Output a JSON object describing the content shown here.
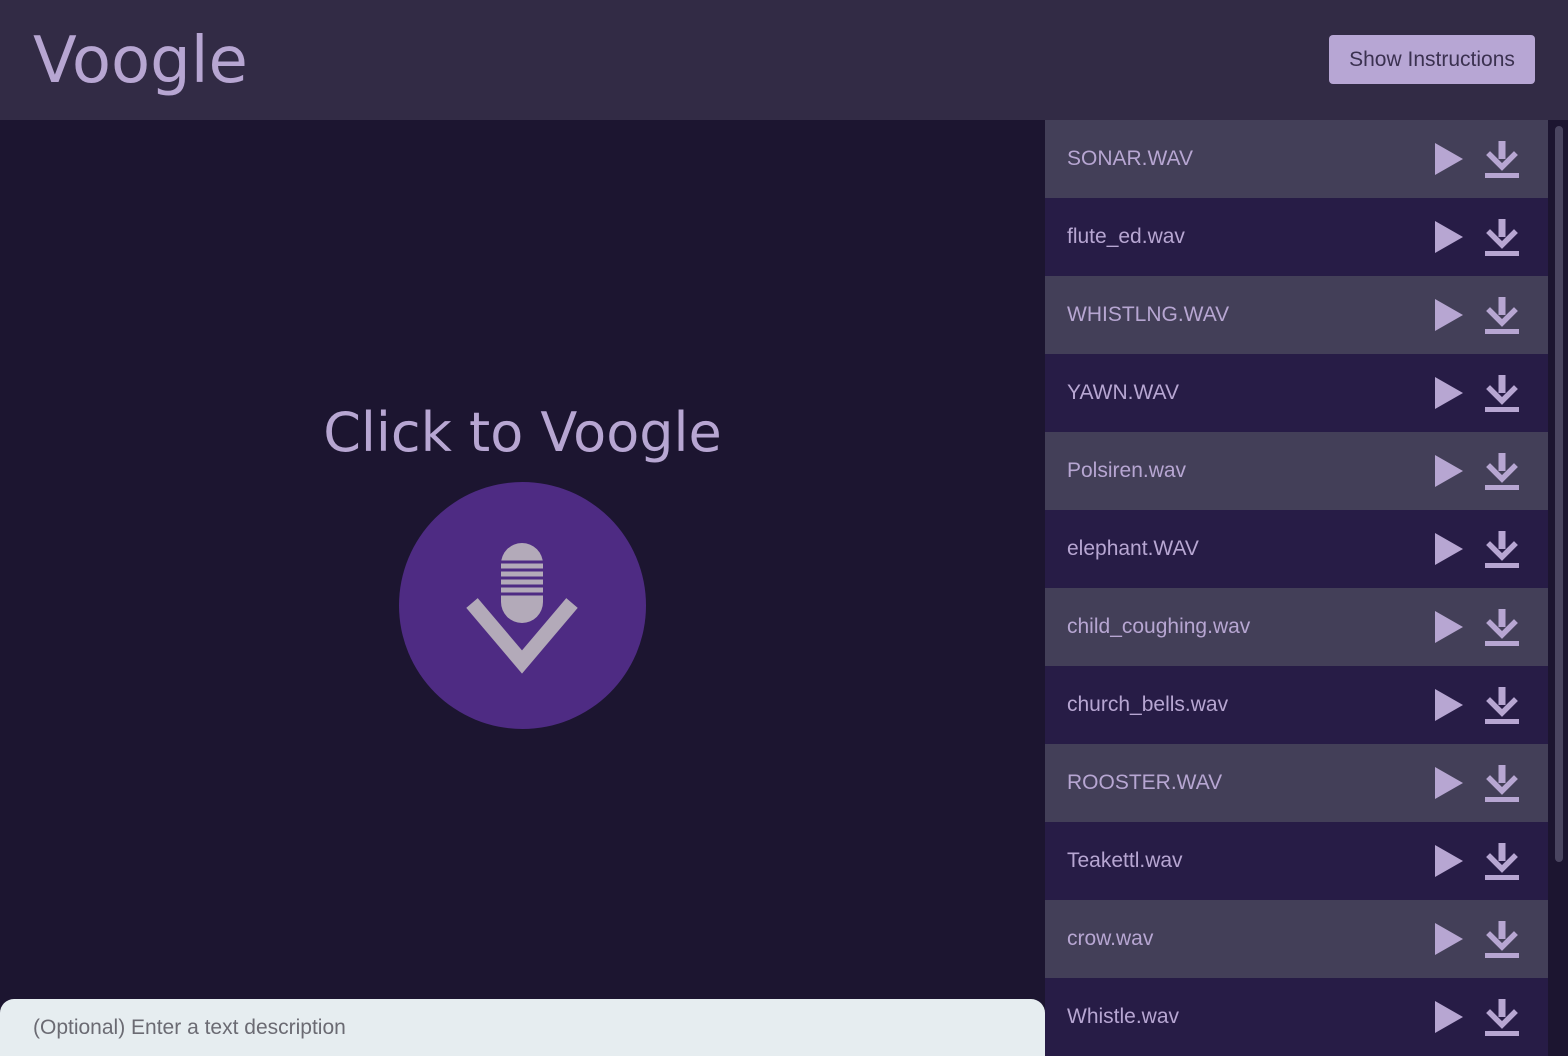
{
  "header": {
    "title": "Voogle",
    "instructions_button": "Show Instructions"
  },
  "main": {
    "cta": "Click to Voogle",
    "mic_icon": "microphone-voogle-icon",
    "search_placeholder": "(Optional) Enter a text description"
  },
  "sounds": [
    "SONAR.WAV",
    "flute_ed.wav",
    "WHISTLNG.WAV",
    "YAWN.WAV",
    "Polsiren.wav",
    "elephant.WAV",
    "child_coughing.wav",
    "church_bells.wav",
    "ROOSTER.WAV",
    "Teakettl.wav",
    "crow.wav",
    "Whistle.wav"
  ],
  "icons": {
    "play": "play-icon",
    "download": "download-icon"
  },
  "colors": {
    "header_bg": "#322b45",
    "main_bg": "#1c1530",
    "accent_text": "#b7a6d2",
    "mic_circle": "#4e2b83",
    "row_light": "#433f58",
    "row_dark": "#271c46",
    "input_bg": "#e6edf0"
  }
}
